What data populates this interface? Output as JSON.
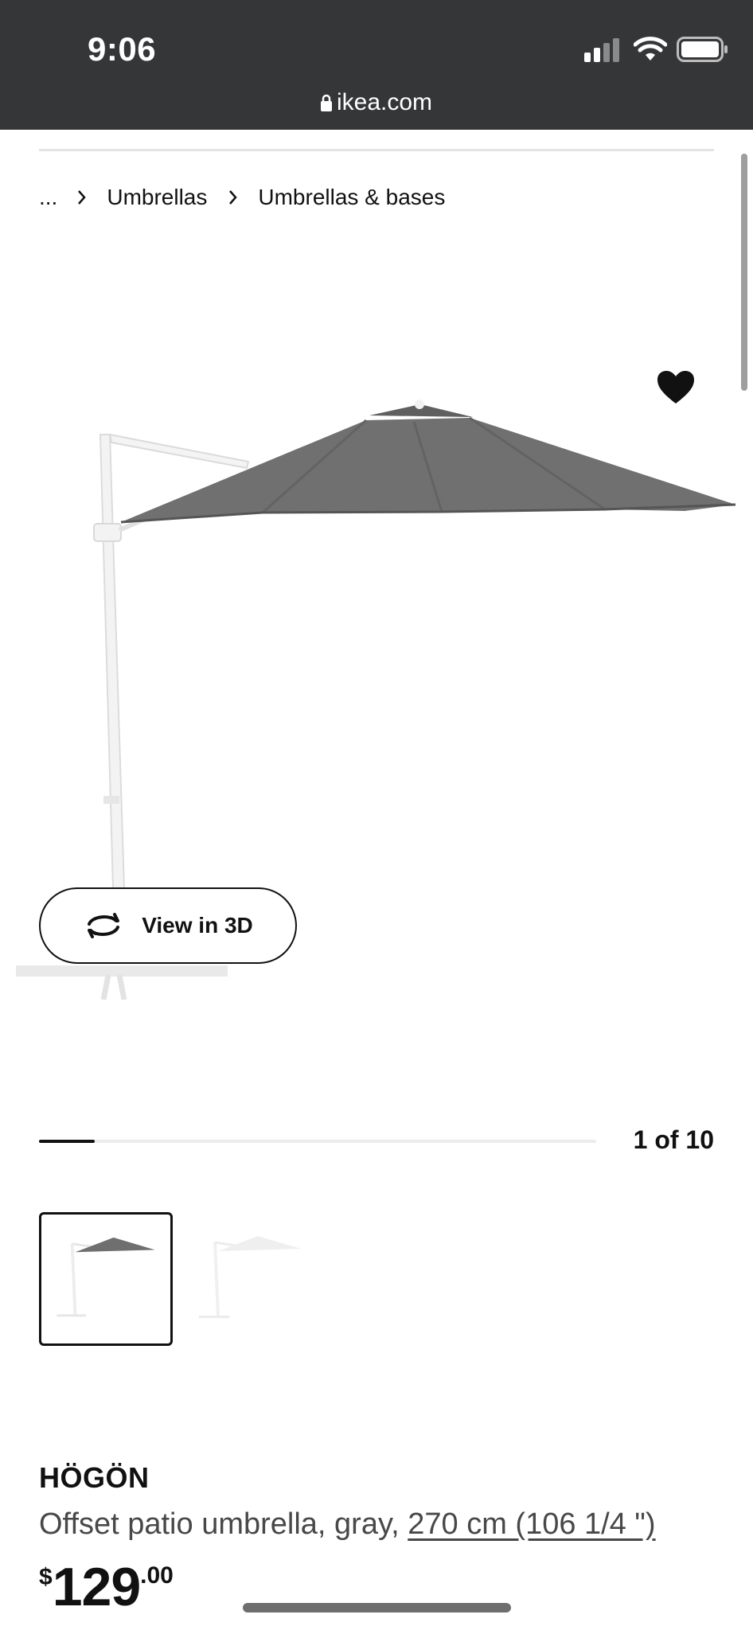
{
  "status_bar": {
    "time": "9:06",
    "url": "ikea.com",
    "icons": [
      "signal-icon",
      "wifi-icon",
      "battery-icon",
      "lock-icon"
    ]
  },
  "breadcrumb": {
    "ellipsis": "...",
    "items": [
      "Umbrellas",
      "Umbrellas & bases"
    ]
  },
  "gallery": {
    "view_3d_label": "View in 3D",
    "counter": "1 of 10",
    "progress": 0.1,
    "thumbnails": [
      {
        "selected": true
      },
      {
        "selected": false
      }
    ]
  },
  "product": {
    "name": "HÖGÖN",
    "description_prefix": "Offset patio umbrella, gray, ",
    "size_link": "270 cm (106 1/4 \")",
    "price_currency": "$",
    "price_whole": "129",
    "price_cents": ".00"
  },
  "colors": {
    "status_bar_bg": "#343638",
    "text": "#111111",
    "secondary_text": "#484848",
    "canopy": "#6f6f6f"
  }
}
